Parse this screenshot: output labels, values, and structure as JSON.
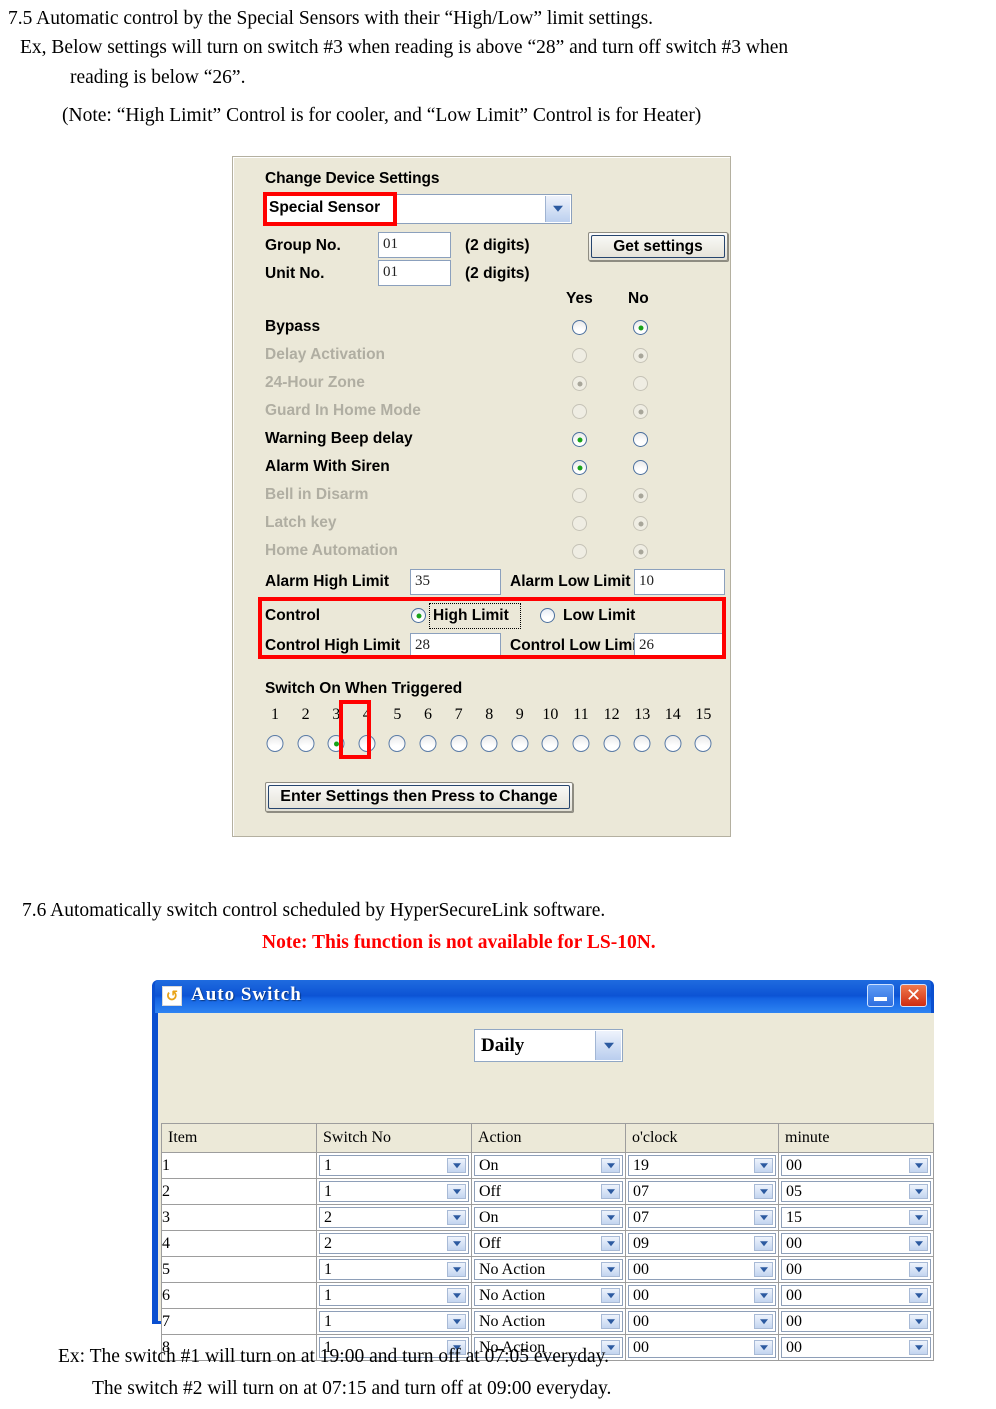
{
  "doc": {
    "section_75": "7.5 Automatic control by the Special Sensors with their “High/Low” limit settings.",
    "example_line1": "Ex, Below settings will turn on switch #3 when reading is above “28” and turn off switch #3 when",
    "example_line2": "reading is below “26”.",
    "note_line": "(Note: “High Limit” Control is for cooler, and “Low Limit” Control is for Heater)",
    "section_76": "7.6 Automatically switch control scheduled by HyperSecureLink software.",
    "ls_note": "Note: This function is not available for LS-10N.",
    "ls_note_color": "#ff0000",
    "example_bottom1": "Ex: The switch #1 will turn on at 19:00 and turn off at 07:05 everyday.",
    "example_bottom2": "The switch #2 will turn on at 07:15 and turn off at 09:00 everyday."
  },
  "device_dialog": {
    "title": "Change Device Settings",
    "sensor_select": {
      "value": "Special Sensor",
      "highlight_color": "#ff0000"
    },
    "group_no": {
      "label": "Group No.",
      "value": "01",
      "hint": "(2 digits)"
    },
    "unit_no": {
      "label": "Unit No.",
      "value": "01",
      "hint": "(2 digits)"
    },
    "get_settings_label": "Get settings",
    "yes_header": "Yes",
    "no_header": "No",
    "options": [
      {
        "label": "Bypass",
        "enabled": true,
        "selected": "no"
      },
      {
        "label": "Delay Activation",
        "enabled": false,
        "selected": "no"
      },
      {
        "label": "24-Hour Zone",
        "enabled": false,
        "selected": "yes"
      },
      {
        "label": "Guard In Home Mode",
        "enabled": false,
        "selected": "no"
      },
      {
        "label": "Warning Beep delay",
        "enabled": true,
        "selected": "yes"
      },
      {
        "label": "Alarm With Siren",
        "enabled": true,
        "selected": "yes"
      },
      {
        "label": "Bell in Disarm",
        "enabled": false,
        "selected": "no"
      },
      {
        "label": "Latch key",
        "enabled": false,
        "selected": "no"
      },
      {
        "label": "Home Automation",
        "enabled": false,
        "selected": "no"
      }
    ],
    "alarm_high_limit": {
      "label": "Alarm High Limit",
      "value": "35"
    },
    "alarm_low_limit": {
      "label": "Alarm Low Limit",
      "value": "10"
    },
    "control": {
      "label": "Control",
      "high_limit_label": "High Limit",
      "low_limit_label": "Low Limit",
      "selected": "high"
    },
    "control_high_limit": {
      "label": "Control High Limit",
      "value": "28"
    },
    "control_low_limit": {
      "label": "Control Low Limit",
      "value": "26"
    },
    "switch_section_title": "Switch On When Triggered",
    "switch_numbers": [
      "1",
      "2",
      "3",
      "4",
      "5",
      "6",
      "7",
      "8",
      "9",
      "10",
      "11",
      "12",
      "13",
      "14",
      "15"
    ],
    "switch_selected": 3,
    "enter_settings_label": "Enter Settings then Press to Change",
    "background_color": "#ebe8d8"
  },
  "auto_switch_window": {
    "title": "Auto Switch",
    "icon": "refresh-icon",
    "minimize_label": "_",
    "close_label": "✕",
    "titlebar_color": "#0a53d4",
    "frequency_select": {
      "value": "Daily"
    },
    "table": {
      "headers": [
        "Item",
        "Switch No",
        "Action",
        "o'clock",
        "minute"
      ],
      "rows": [
        {
          "item": "1",
          "switch_no": "1",
          "action": "On",
          "oclock": "19",
          "minute": "00"
        },
        {
          "item": "2",
          "switch_no": "1",
          "action": "Off",
          "oclock": "07",
          "minute": "05"
        },
        {
          "item": "3",
          "switch_no": "2",
          "action": "On",
          "oclock": "07",
          "minute": "15"
        },
        {
          "item": "4",
          "switch_no": "2",
          "action": "Off",
          "oclock": "09",
          "minute": "00"
        },
        {
          "item": "5",
          "switch_no": "1",
          "action": "No Action",
          "oclock": "00",
          "minute": "00"
        },
        {
          "item": "6",
          "switch_no": "1",
          "action": "No Action",
          "oclock": "00",
          "minute": "00"
        },
        {
          "item": "7",
          "switch_no": "1",
          "action": "No Action",
          "oclock": "00",
          "minute": "00"
        },
        {
          "item": "8",
          "switch_no": "1",
          "action": "No Action",
          "oclock": "00",
          "minute": "00"
        }
      ]
    }
  }
}
